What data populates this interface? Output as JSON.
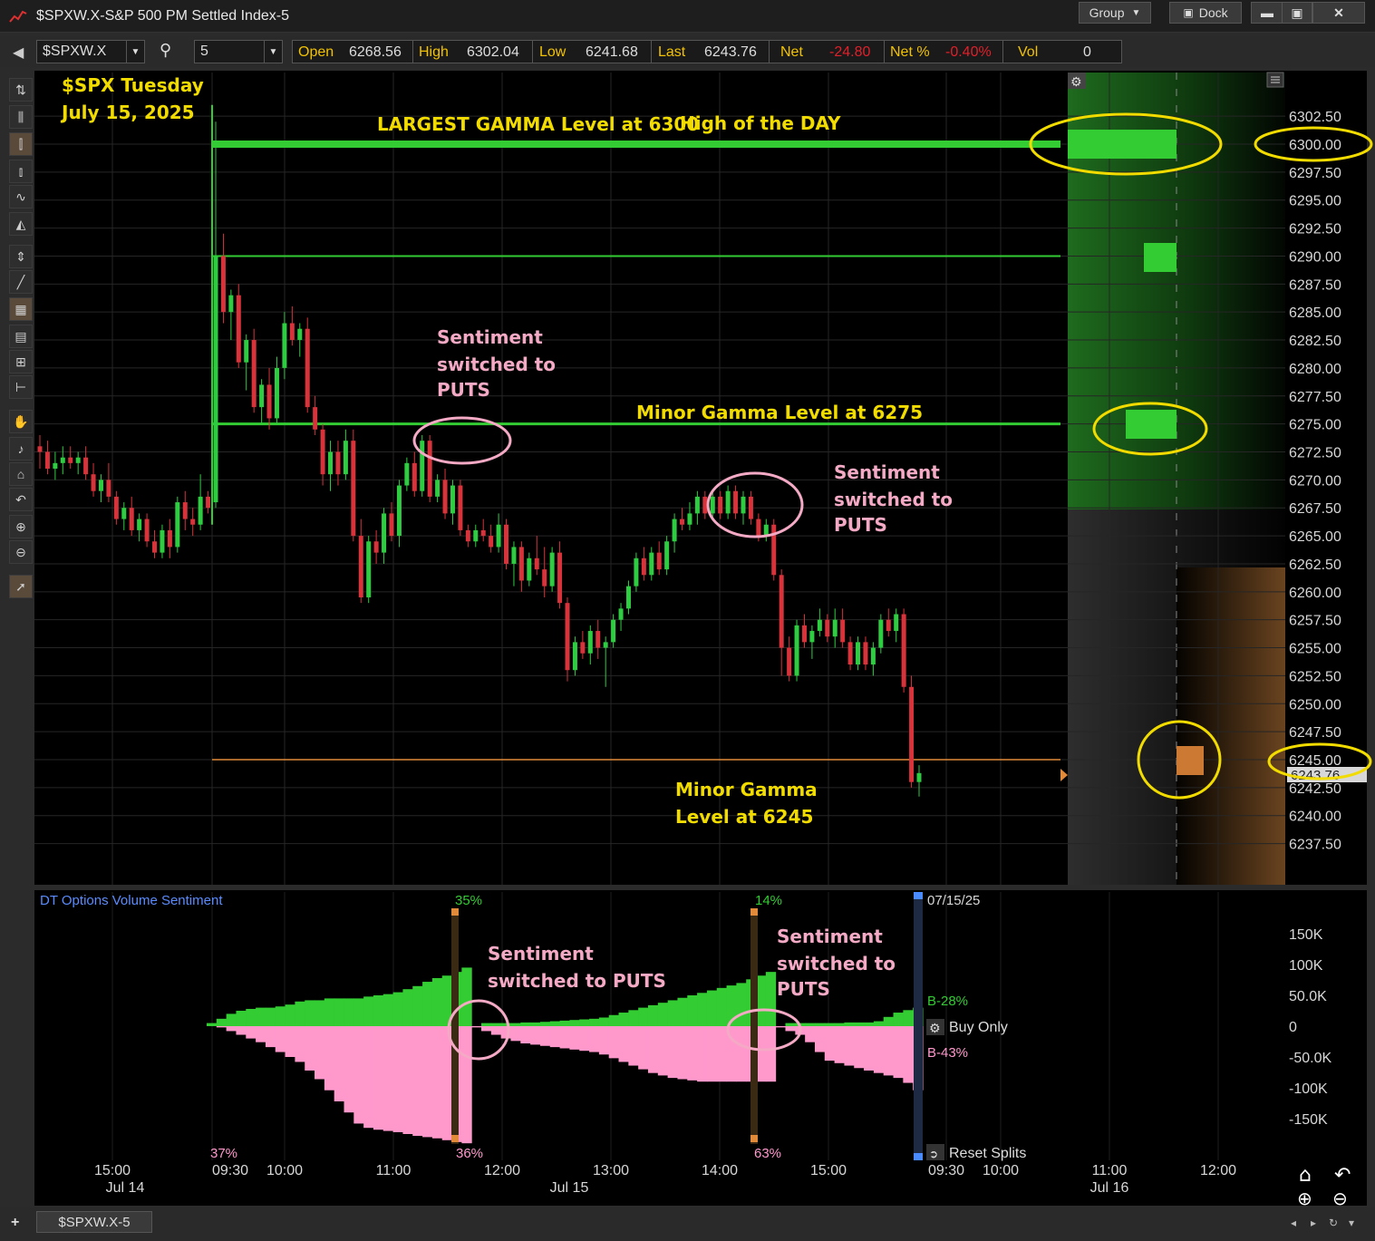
{
  "window": {
    "title": "$SPXW.X-S&P 500 PM Settled Index-5",
    "group_label": "Group",
    "dock_label": "Dock"
  },
  "toolbar": {
    "symbol": "$SPXW.X",
    "interval": "5"
  },
  "quote": {
    "open_label": "Open",
    "open": "6268.56",
    "high_label": "High",
    "high": "6302.04",
    "low_label": "Low",
    "low": "6241.68",
    "last_label": "Last",
    "last": "6243.76",
    "net_label": "Net",
    "net": "-24.80",
    "netpct_label": "Net %",
    "netpct": "-0.40%",
    "vol_label": "Vol",
    "vol": "0"
  },
  "colors": {
    "up": "#2ecc40",
    "down": "#d8323a",
    "puts": "#ff99cc",
    "calls": "#33cc33",
    "annotation_yellow": "#f2dc00",
    "annotation_pink": "#f4a9c4",
    "orange": "#e08a3a"
  },
  "annotations": {
    "date_line1": "$SPX Tuesday",
    "date_line2": "July 15, 2025",
    "largest_gamma": "LARGEST GAMMA Level at 6300",
    "high_of_day": "High of the DAY",
    "sentiment1_l1": "Sentiment",
    "sentiment1_l2": "switched to",
    "sentiment1_l3": "PUTS",
    "minor_6275": "Minor Gamma Level at 6275",
    "sentiment2_l1": "Sentiment",
    "sentiment2_l2": "switched to",
    "sentiment2_l3": "PUTS",
    "minor_6245_l1": "Minor Gamma",
    "minor_6245_l2": "Level at 6245",
    "lower_s1_l1": "Sentiment",
    "lower_s1_l2": "switched to PUTS",
    "lower_s2_l1": "Sentiment",
    "lower_s2_l2": "switched to",
    "lower_s2_l3": "PUTS"
  },
  "price_axis": {
    "labels": [
      "6302.50",
      "6300.00",
      "6297.50",
      "6295.00",
      "6292.50",
      "6290.00",
      "6287.50",
      "6285.00",
      "6282.50",
      "6280.00",
      "6277.50",
      "6275.00",
      "6272.50",
      "6270.00",
      "6267.50",
      "6265.00",
      "6262.50",
      "6260.00",
      "6257.50",
      "6255.00",
      "6252.50",
      "6250.00",
      "6247.50",
      "6245.00",
      "6242.50",
      "6240.00",
      "6237.50"
    ],
    "last_marker": "6243.76"
  },
  "sentiment_panel": {
    "title": "DT Options Volume Sentiment",
    "axis_labels": [
      "150K",
      "100K",
      "50.0K",
      "0",
      "-50.0K",
      "-100K",
      "-150K"
    ],
    "pct_top_1": "35%",
    "pct_top_2": "14%",
    "pct_bottom_0": "37%",
    "pct_bottom_1": "36%",
    "pct_bottom_2": "63%",
    "date": "07/15/25",
    "buy_label": "B-28%",
    "sell_label": "B-43%",
    "buy_only": "Buy Only",
    "reset_splits": "Reset Splits"
  },
  "time_axis": {
    "ticks": [
      "15:00",
      "09:30",
      "10:00",
      "11:00",
      "12:00",
      "13:00",
      "14:00",
      "15:00",
      "09:30",
      "10:00",
      "11:00",
      "12:00"
    ],
    "dates": [
      "Jul 14",
      "Jul 15",
      "Jul 16"
    ]
  },
  "statusbar": {
    "tab_label": "$SPXW.X-5"
  },
  "chart_data": {
    "type": "candlestick",
    "title": "$SPXW.X-S&P 500 PM Settled Index-5",
    "y_range": [
      6236,
      6305
    ],
    "gamma_levels": [
      6300,
      6290,
      6275,
      6245
    ],
    "candles_ohlc": [
      [
        6273.0,
        6274.0,
        6271.0,
        6272.5
      ],
      [
        6272.5,
        6273.5,
        6270.5,
        6271.0
      ],
      [
        6271.0,
        6272.5,
        6270.0,
        6271.5
      ],
      [
        6271.5,
        6273.0,
        6270.5,
        6272.0
      ],
      [
        6272.0,
        6273.0,
        6271.0,
        6271.5
      ],
      [
        6271.5,
        6272.5,
        6270.5,
        6272.0
      ],
      [
        6272.0,
        6273.0,
        6270.0,
        6270.5
      ],
      [
        6270.5,
        6271.5,
        6268.5,
        6269.0
      ],
      [
        6269.0,
        6270.5,
        6268.0,
        6270.0
      ],
      [
        6270.0,
        6271.5,
        6268.0,
        6268.5
      ],
      [
        6268.5,
        6269.0,
        6266.0,
        6266.5
      ],
      [
        6266.5,
        6268.0,
        6265.5,
        6267.5
      ],
      [
        6267.5,
        6268.5,
        6265.0,
        6265.5
      ],
      [
        6265.5,
        6267.0,
        6264.5,
        6266.5
      ],
      [
        6266.5,
        6267.0,
        6264.0,
        6264.5
      ],
      [
        6264.5,
        6265.5,
        6263.0,
        6263.5
      ],
      [
        6263.5,
        6266.0,
        6263.0,
        6265.5
      ],
      [
        6265.5,
        6266.5,
        6263.0,
        6264.0
      ],
      [
        6264.0,
        6268.5,
        6263.5,
        6268.0
      ],
      [
        6268.0,
        6269.0,
        6265.5,
        6266.5
      ],
      [
        6266.5,
        6267.5,
        6265.0,
        6266.0
      ],
      [
        6266.0,
        6270.5,
        6265.5,
        6268.5
      ],
      [
        6268.5,
        6269.0,
        6267.0,
        6267.5
      ],
      [
        6268.0,
        6302.0,
        6267.5,
        6290.0
      ],
      [
        6290.0,
        6292.0,
        6284.0,
        6285.0
      ],
      [
        6285.0,
        6287.0,
        6282.5,
        6286.5
      ],
      [
        6286.5,
        6287.5,
        6280.0,
        6280.5
      ],
      [
        6280.5,
        6283.0,
        6278.0,
        6282.5
      ],
      [
        6282.5,
        6283.5,
        6276.0,
        6276.5
      ],
      [
        6276.5,
        6279.0,
        6275.0,
        6278.5
      ],
      [
        6278.5,
        6280.0,
        6274.5,
        6275.5
      ],
      [
        6275.5,
        6281.0,
        6275.0,
        6280.0
      ],
      [
        6280.0,
        6285.0,
        6279.0,
        6284.0
      ],
      [
        6284.0,
        6285.5,
        6282.0,
        6282.5
      ],
      [
        6282.5,
        6284.0,
        6281.0,
        6283.5
      ],
      [
        6283.5,
        6284.5,
        6276.0,
        6276.5
      ],
      [
        6276.5,
        6277.5,
        6274.0,
        6274.5
      ],
      [
        6274.5,
        6275.0,
        6269.5,
        6270.5
      ],
      [
        6270.5,
        6273.5,
        6269.0,
        6272.5
      ],
      [
        6272.5,
        6273.5,
        6269.5,
        6270.5
      ],
      [
        6270.5,
        6274.5,
        6270.0,
        6273.5
      ],
      [
        6273.5,
        6274.5,
        6264.5,
        6265.0
      ],
      [
        6265.0,
        6266.5,
        6259.0,
        6259.5
      ],
      [
        6259.5,
        6265.0,
        6259.0,
        6264.5
      ],
      [
        6264.5,
        6265.5,
        6262.5,
        6263.5
      ],
      [
        6263.5,
        6267.5,
        6262.5,
        6267.0
      ],
      [
        6267.0,
        6268.0,
        6264.5,
        6265.0
      ],
      [
        6265.0,
        6270.0,
        6264.0,
        6269.5
      ],
      [
        6269.5,
        6272.0,
        6269.0,
        6271.5
      ],
      [
        6271.5,
        6272.5,
        6268.5,
        6269.0
      ],
      [
        6269.0,
        6274.0,
        6268.5,
        6273.5
      ],
      [
        6273.5,
        6274.0,
        6268.0,
        6268.5
      ],
      [
        6268.5,
        6270.5,
        6268.0,
        6270.0
      ],
      [
        6270.0,
        6271.0,
        6266.5,
        6267.0
      ],
      [
        6267.0,
        6270.0,
        6266.0,
        6269.5
      ],
      [
        6269.5,
        6270.0,
        6265.0,
        6265.5
      ],
      [
        6265.5,
        6266.0,
        6264.0,
        6264.5
      ],
      [
        6264.5,
        6266.0,
        6264.0,
        6265.5
      ],
      [
        6265.5,
        6266.5,
        6264.5,
        6265.0
      ],
      [
        6265.0,
        6266.0,
        6263.5,
        6264.0
      ],
      [
        6264.0,
        6267.0,
        6263.5,
        6266.0
      ],
      [
        6266.0,
        6266.5,
        6262.0,
        6262.5
      ],
      [
        6262.5,
        6264.5,
        6260.5,
        6264.0
      ],
      [
        6264.0,
        6264.5,
        6260.0,
        6261.0
      ],
      [
        6261.0,
        6263.5,
        6260.5,
        6263.0
      ],
      [
        6263.0,
        6265.0,
        6261.5,
        6262.0
      ],
      [
        6262.0,
        6264.0,
        6259.5,
        6260.5
      ],
      [
        6260.5,
        6264.0,
        6260.0,
        6263.5
      ],
      [
        6263.5,
        6264.5,
        6258.5,
        6259.0
      ],
      [
        6259.0,
        6259.5,
        6252.0,
        6253.0
      ],
      [
        6253.0,
        6256.0,
        6252.5,
        6255.5
      ],
      [
        6255.5,
        6256.5,
        6254.0,
        6254.5
      ],
      [
        6254.5,
        6257.0,
        6253.5,
        6256.5
      ],
      [
        6256.5,
        6257.5,
        6254.0,
        6255.0
      ],
      [
        6255.0,
        6256.0,
        6251.5,
        6255.5
      ],
      [
        6255.5,
        6258.0,
        6255.0,
        6257.5
      ],
      [
        6257.5,
        6259.0,
        6256.5,
        6258.5
      ],
      [
        6258.5,
        6261.0,
        6258.0,
        6260.5
      ],
      [
        6260.5,
        6263.5,
        6260.0,
        6263.0
      ],
      [
        6263.0,
        6264.0,
        6261.0,
        6261.5
      ],
      [
        6261.5,
        6264.0,
        6261.0,
        6263.5
      ],
      [
        6263.5,
        6264.5,
        6261.5,
        6262.0
      ],
      [
        6262.0,
        6265.0,
        6261.5,
        6264.5
      ],
      [
        6264.5,
        6267.0,
        6263.5,
        6266.5
      ],
      [
        6266.5,
        6267.5,
        6265.5,
        6266.0
      ],
      [
        6266.0,
        6268.0,
        6265.5,
        6267.0
      ],
      [
        6267.0,
        6269.0,
        6266.0,
        6268.5
      ],
      [
        6268.5,
        6269.0,
        6266.5,
        6267.0
      ],
      [
        6267.0,
        6269.0,
        6266.5,
        6268.5
      ],
      [
        6268.5,
        6269.0,
        6266.5,
        6267.0
      ],
      [
        6267.0,
        6269.5,
        6266.5,
        6269.0
      ],
      [
        6269.0,
        6269.5,
        6266.5,
        6267.0
      ],
      [
        6267.0,
        6269.0,
        6266.0,
        6268.5
      ],
      [
        6268.5,
        6269.0,
        6266.0,
        6266.5
      ],
      [
        6266.5,
        6267.0,
        6264.5,
        6265.0
      ],
      [
        6265.0,
        6266.5,
        6264.5,
        6266.0
      ],
      [
        6266.0,
        6266.5,
        6261.0,
        6261.5
      ],
      [
        6261.5,
        6262.0,
        6252.5,
        6255.0
      ],
      [
        6255.0,
        6256.0,
        6252.0,
        6252.5
      ],
      [
        6252.5,
        6257.5,
        6252.0,
        6257.0
      ],
      [
        6257.0,
        6258.0,
        6255.0,
        6255.5
      ],
      [
        6255.5,
        6257.0,
        6254.0,
        6256.5
      ],
      [
        6256.5,
        6258.5,
        6256.0,
        6257.5
      ],
      [
        6257.5,
        6258.0,
        6255.5,
        6256.0
      ],
      [
        6256.0,
        6258.5,
        6255.0,
        6257.5
      ],
      [
        6257.5,
        6258.5,
        6255.0,
        6255.5
      ],
      [
        6255.5,
        6256.0,
        6253.0,
        6253.5
      ],
      [
        6253.5,
        6256.0,
        6253.0,
        6255.5
      ],
      [
        6255.5,
        6256.0,
        6253.0,
        6253.5
      ],
      [
        6253.5,
        6255.5,
        6252.5,
        6255.0
      ],
      [
        6255.0,
        6258.0,
        6254.5,
        6257.5
      ],
      [
        6257.5,
        6258.5,
        6256.0,
        6256.5
      ],
      [
        6256.5,
        6258.5,
        6255.5,
        6258.0
      ],
      [
        6258.0,
        6258.5,
        6251.0,
        6251.5
      ],
      [
        6251.5,
        6252.5,
        6242.5,
        6243.0
      ],
      [
        6243.0,
        6244.5,
        6241.7,
        6243.8
      ]
    ],
    "sentiment_calls_k": [
      5,
      12,
      20,
      25,
      28,
      30,
      30,
      32,
      35,
      40,
      42,
      42,
      45,
      45,
      45,
      45,
      48,
      50,
      52,
      55,
      60,
      65,
      72,
      78,
      82,
      88,
      95,
      0,
      5,
      5,
      5,
      5,
      6,
      6,
      7,
      8,
      9,
      10,
      11,
      12,
      14,
      18,
      22,
      26,
      30,
      34,
      38,
      42,
      46,
      50,
      54,
      58,
      62,
      66,
      70,
      76,
      82,
      88,
      0,
      5,
      5,
      5,
      5,
      5,
      5,
      6,
      6,
      6,
      8,
      15,
      22,
      26,
      30
    ],
    "sentiment_puts_k": [
      0,
      -2,
      -8,
      -14,
      -20,
      -26,
      -34,
      -42,
      -50,
      -58,
      -72,
      -86,
      -104,
      -122,
      -140,
      -158,
      -165,
      -168,
      -170,
      -172,
      -175,
      -178,
      -180,
      -182,
      -185,
      -188,
      -190,
      -2,
      -8,
      -14,
      -20,
      -24,
      -28,
      -30,
      -32,
      -34,
      -36,
      -38,
      -40,
      -42,
      -46,
      -52,
      -58,
      -64,
      -70,
      -76,
      -80,
      -84,
      -86,
      -88,
      -90,
      -90,
      -90,
      -90,
      -90,
      -90,
      -90,
      -90,
      -2,
      -8,
      -14,
      -26,
      -42,
      -56,
      -60,
      -64,
      -68,
      -72,
      -76,
      -80,
      -84,
      -92,
      -104
    ]
  }
}
